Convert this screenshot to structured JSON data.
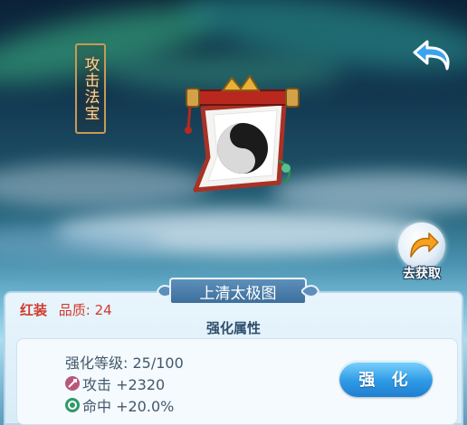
{
  "screen": {
    "category_label": "攻击法宝",
    "acquire_label": "去获取"
  },
  "artifact": {
    "name": "上清太极图",
    "grade": "红装",
    "quality_label": "品质: 24",
    "icon": "taiji-scroll-icon"
  },
  "enhance": {
    "section_title": "强化属性",
    "level_label": "强化等级: 25/100",
    "attack_label": "攻击 +2320",
    "accuracy_label": "命中 +20.0%",
    "button_label": "强 化"
  },
  "colors": {
    "grade_red": "#d13a2e",
    "button_blue": "#2f9be6",
    "frame_gold": "#c89a55"
  }
}
